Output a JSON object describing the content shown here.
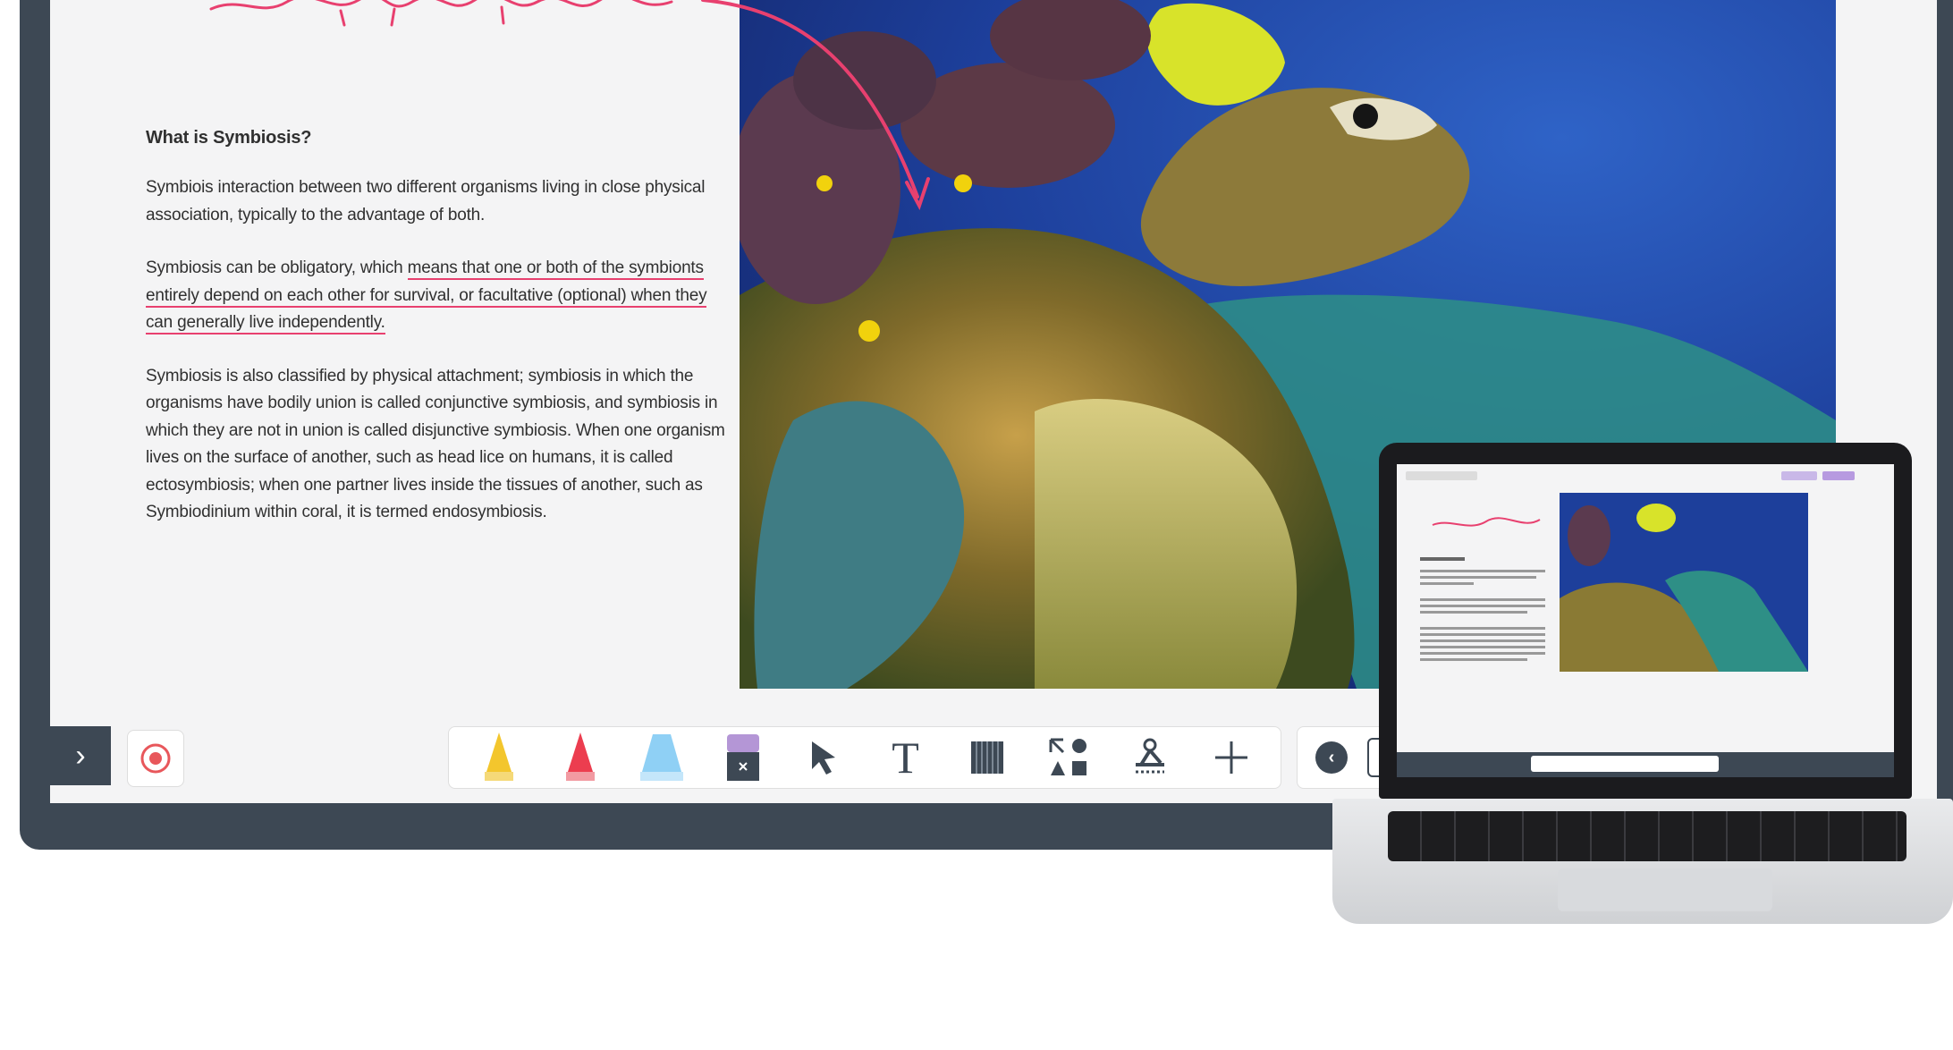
{
  "text": {
    "heading": "What is Symbiosis?",
    "p1": "Symbiois interaction between two different organisms living in close physical association, typically to the advantage of both.",
    "p2_a": "Symbiosis can be obligatory, which ",
    "p2_b": "means that one or both of the symbionts entirely depend on each other for survival, or facultative (optional) when they can generally live independently.",
    "p3": "Symbiosis is also classified by physical attachment; symbiosis in which the organisms have bodily union is called conjunctive symbiosis, and symbiosis in which they are not in union is called disjunctive symbiosis. When one organism lives on the surface of another, such as head lice on humans, it is called ectosymbiosis; when one partner lives inside the tissues of another, such as Symbiodinium within coral, it is termed endosymbiosis."
  },
  "toolbar": {
    "expand_icon": "chevron-right-icon",
    "record_icon": "record-icon",
    "tools": [
      {
        "name": "yellow-marker-icon",
        "color": "#f3c62d"
      },
      {
        "name": "red-marker-icon",
        "color": "#ec3d4f"
      },
      {
        "name": "blue-highlighter-icon",
        "color": "#8fd0f5"
      },
      {
        "name": "eraser-icon",
        "color": "#b496d6"
      },
      {
        "name": "select-pointer-icon"
      },
      {
        "name": "text-tool-icon",
        "label": "T"
      },
      {
        "name": "background-pattern-icon"
      },
      {
        "name": "shapes-icon"
      },
      {
        "name": "tools-icon"
      },
      {
        "name": "add-icon"
      }
    ]
  },
  "colors": {
    "bezel": "#3d4854",
    "annotation_pink": "#e8406f",
    "ocean": "#1f3f9a"
  }
}
